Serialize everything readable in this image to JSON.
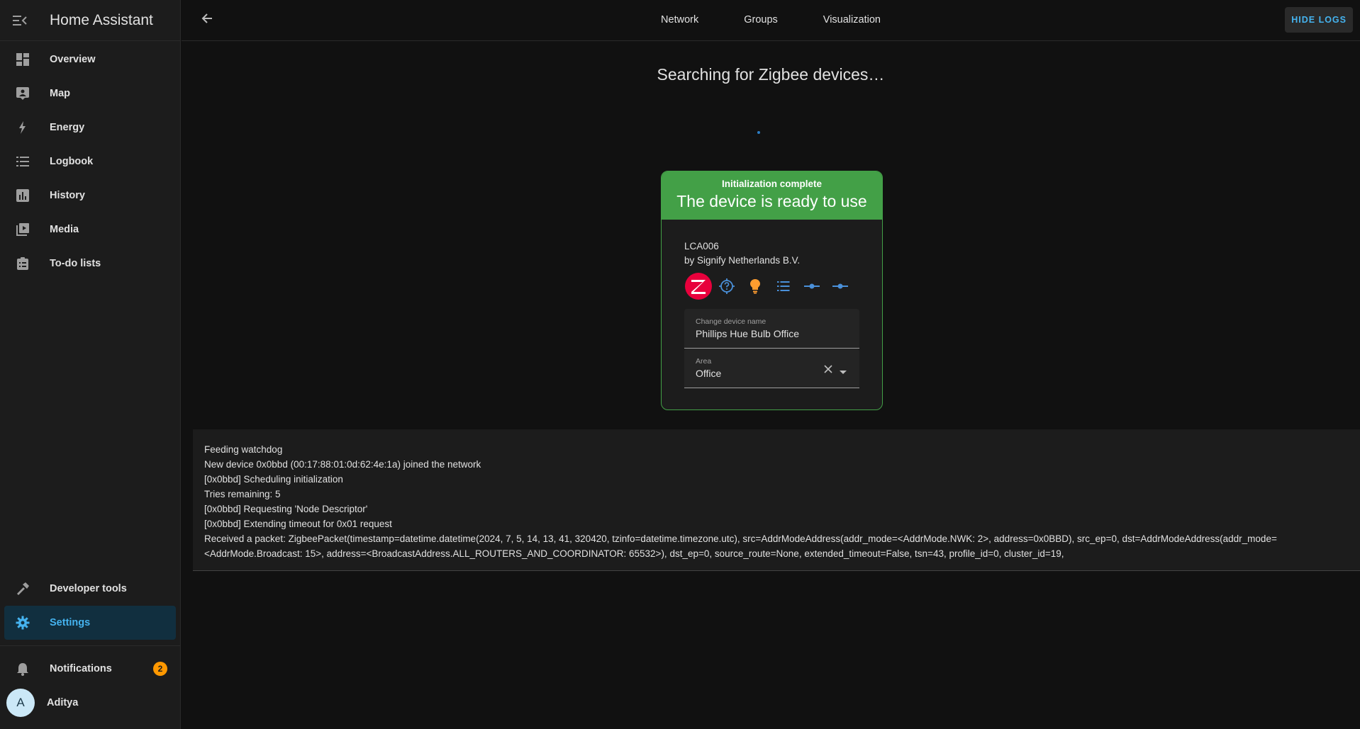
{
  "app": {
    "title": "Home Assistant"
  },
  "sidebar": {
    "items": [
      {
        "label": "Overview",
        "icon": "dashboard-icon"
      },
      {
        "label": "Map",
        "icon": "map-icon"
      },
      {
        "label": "Energy",
        "icon": "lightning-icon"
      },
      {
        "label": "Logbook",
        "icon": "list-icon"
      },
      {
        "label": "History",
        "icon": "chart-icon"
      },
      {
        "label": "Media",
        "icon": "media-icon"
      },
      {
        "label": "To-do lists",
        "icon": "clipboard-icon"
      }
    ],
    "bottom": [
      {
        "label": "Developer tools",
        "icon": "hammer-icon"
      },
      {
        "label": "Settings",
        "icon": "gear-icon",
        "active": true
      }
    ],
    "notifications": {
      "label": "Notifications",
      "count": "2"
    },
    "user": {
      "initial": "A",
      "name": "Aditya"
    }
  },
  "topbar": {
    "tabs": [
      "Network",
      "Groups",
      "Visualization"
    ],
    "hide_logs": "HIDE LOGS"
  },
  "main": {
    "search_title": "Searching for Zigbee devices…"
  },
  "card": {
    "status_small": "Initialization complete",
    "status_big": "The device is ready to use",
    "model": "LCA006",
    "manufacturer": "by Signify Netherlands B.V.",
    "name_field": {
      "label": "Change device name",
      "value": "Phillips Hue Bulb Office"
    },
    "area_field": {
      "label": "Area",
      "value": "Office"
    }
  },
  "logs": [
    "Feeding watchdog",
    "New device 0x0bbd (00:17:88:01:0d:62:4e:1a) joined the network",
    "[0x0bbd] Scheduling initialization",
    "Tries remaining: 5",
    "[0x0bbd] Requesting 'Node Descriptor'",
    "[0x0bbd] Extending timeout for 0x01 request",
    "Received a packet: ZigbeePacket(timestamp=datetime.datetime(2024, 7, 5, 14, 13, 41, 320420, tzinfo=datetime.timezone.utc), src=AddrModeAddress(addr_mode=<AddrMode.NWK: 2>, address=0x0BBD), src_ep=0, dst=AddrModeAddress(addr_mode=<AddrMode.Broadcast: 15>, address=<BroadcastAddress.ALL_ROUTERS_AND_COORDINATOR: 65532>), dst_ep=0, source_route=None, extended_timeout=False, tsn=43, profile_id=0, cluster_id=19,"
  ],
  "colors": {
    "accent": "#45b3ef",
    "success": "#43a047",
    "badge": "#ff9800",
    "zigbee": "#e8003c"
  }
}
